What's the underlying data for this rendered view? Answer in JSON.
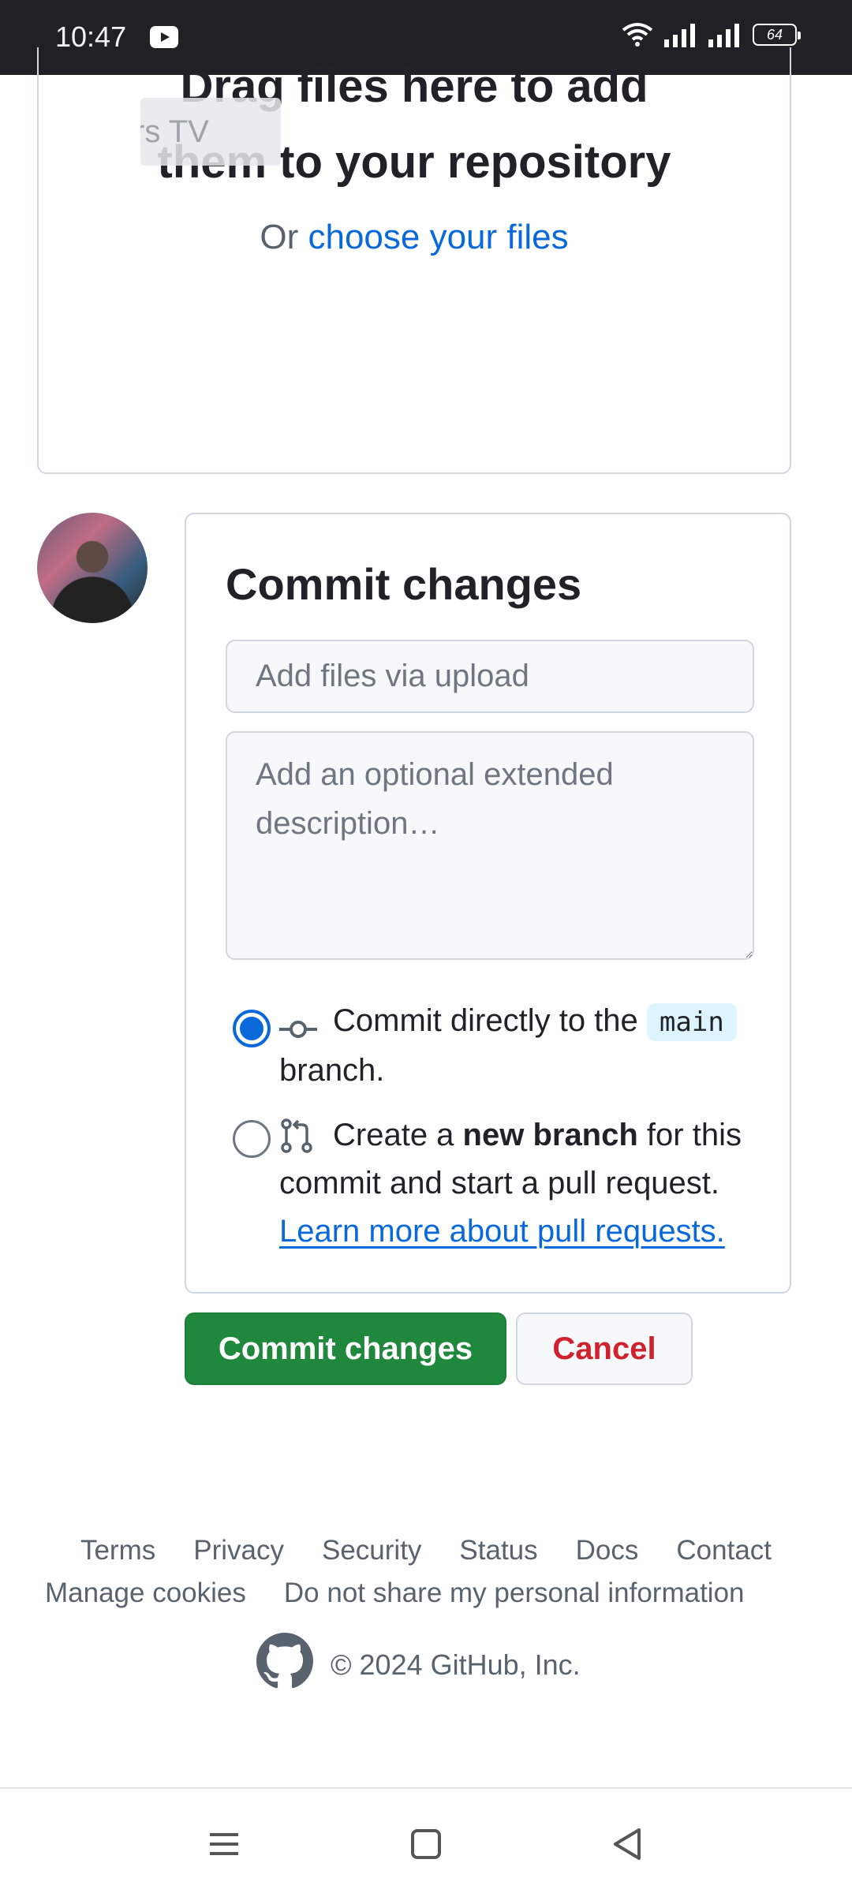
{
  "status_bar": {
    "time": "10:47",
    "battery": "64",
    "icons": [
      "youtube-icon",
      "wifi-icon",
      "signal-icon",
      "signal-icon",
      "battery-icon"
    ]
  },
  "dropzone": {
    "line1": "Drag files here to add",
    "line2": "them to your repository",
    "or_text": "Or ",
    "choose_link": "choose your files"
  },
  "toast": {
    "text": "rs TV"
  },
  "commit": {
    "title": "Commit changes",
    "summary_placeholder": "Add files via upload",
    "description_placeholder": "Add an optional extended description…",
    "option_direct": {
      "text_before": "Commit directly to the",
      "branch": "main",
      "text_after": "branch.",
      "selected": true
    },
    "option_new_branch": {
      "text_before": "Create a ",
      "bold": "new branch",
      "text_after": " for this commit and start a pull request.",
      "link": "Learn more about pull requests.",
      "selected": false
    }
  },
  "buttons": {
    "commit": "Commit changes",
    "cancel": "Cancel"
  },
  "footer": {
    "links_row1": [
      "Terms",
      "Privacy",
      "Security",
      "Status",
      "Docs",
      "Contact"
    ],
    "links_row2": [
      "Manage cookies",
      "Do not share my personal information"
    ],
    "copyright": "© 2024 GitHub, Inc."
  },
  "colors": {
    "accent_blue": "#0969da",
    "primary_green": "#1f883d",
    "danger_red": "#cf222e"
  }
}
